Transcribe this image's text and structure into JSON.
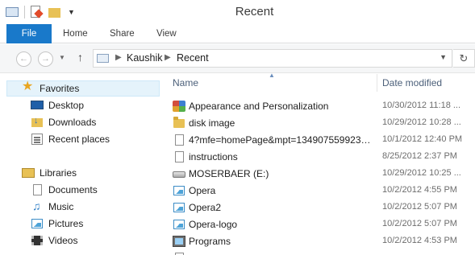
{
  "window": {
    "title": "Recent"
  },
  "ribbon": {
    "tabs": [
      "File",
      "Home",
      "Share",
      "View"
    ]
  },
  "address": {
    "crumbs": [
      "Kaushik",
      "Recent"
    ]
  },
  "nav": {
    "favorites": {
      "label": "Favorites",
      "items": [
        "Desktop",
        "Downloads",
        "Recent places"
      ]
    },
    "libraries": {
      "label": "Libraries",
      "items": [
        "Documents",
        "Music",
        "Pictures",
        "Videos"
      ]
    }
  },
  "list": {
    "columns": {
      "name": "Name",
      "date": "Date modified"
    },
    "rows": [
      {
        "name": "Appearance and Personalization",
        "date": "10/30/2012 11:18 ...",
        "icon": "control-panel-icon"
      },
      {
        "name": "disk image",
        "date": "10/29/2012 10:28 ...",
        "icon": "folder-icon"
      },
      {
        "name": "4?mfe=homePage&mpt=1349075599234...",
        "date": "10/1/2012 12:40 PM",
        "icon": "document-icon"
      },
      {
        "name": "instructions",
        "date": "8/25/2012 2:37 PM",
        "icon": "document-icon"
      },
      {
        "name": "MOSERBAER (E:)",
        "date": "10/29/2012 10:25 ...",
        "icon": "drive-icon"
      },
      {
        "name": "Opera",
        "date": "10/2/2012 4:55 PM",
        "icon": "image-icon"
      },
      {
        "name": "Opera2",
        "date": "10/2/2012 5:07 PM",
        "icon": "image-icon"
      },
      {
        "name": "Opera-logo",
        "date": "10/2/2012 5:07 PM",
        "icon": "image-icon"
      },
      {
        "name": "Programs",
        "date": "10/2/2012 4:53 PM",
        "icon": "programs-icon"
      }
    ]
  },
  "colors": {
    "file_tab": "#1979ca",
    "header_text": "#4c607a",
    "selection": "#e5f3fb"
  }
}
